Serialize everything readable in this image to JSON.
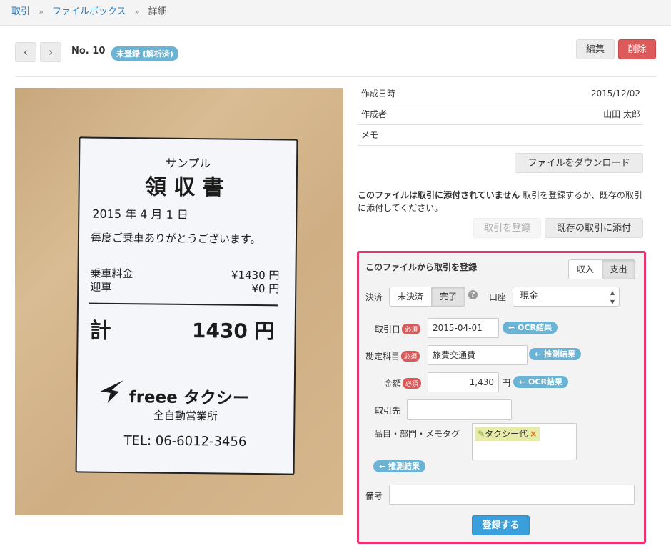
{
  "breadcrumb": {
    "items": [
      "取引",
      "ファイルボックス"
    ],
    "current": "詳細",
    "sep": "»"
  },
  "header": {
    "prev_label": "‹",
    "next_label": "›",
    "record_no": "No. 10",
    "status": "未登録 (解析済)",
    "edit_label": "編集",
    "delete_label": "削除"
  },
  "receipt": {
    "sample": "サンプル",
    "title": "領収書",
    "date": "2015 年 4 月 1 日",
    "thanks": "毎度ご乗車ありがとうございます。",
    "fare_label": "乗車料金",
    "fare_value": "¥1430 円",
    "pickup_label": "迎車",
    "pickup_value": "¥0 円",
    "total_label": "計",
    "total_value": "1430 円",
    "brand": "freee タクシー",
    "office": "全自動営業所",
    "tel": "TEL: 06-6012-3456"
  },
  "info": {
    "created_at_label": "作成日時",
    "created_at": "2015/12/02",
    "author_label": "作成者",
    "author": "山田 太郎",
    "memo_label": "メモ",
    "memo": ""
  },
  "download_label": "ファイルをダウンロード",
  "notice": {
    "bold": "このファイルは取引に添付されていません",
    "rest": "取引を登録するか、既存の取引に添付してください。"
  },
  "actions": {
    "register": "取引を登録",
    "attach": "既存の取引に添付"
  },
  "form": {
    "title": "このファイルから取引を登録",
    "income": "収入",
    "expense": "支出",
    "settlement_label": "決済",
    "unsettled": "未決済",
    "settled": "完了",
    "help": "?",
    "account_label": "口座",
    "account_value": "現金",
    "required": "必須",
    "date_label": "取引日",
    "date_value": "2015-04-01",
    "date_hint": "← OCR結果",
    "category_label": "勘定科目",
    "category_value": "旅費交通費",
    "category_hint": "← 推測結果",
    "amount_label": "金額",
    "amount_value": "1,430",
    "amount_unit": "円",
    "amount_hint": "← OCR結果",
    "partner_label": "取引先",
    "partner_value": "",
    "tags_label": "品目・部門・メモタグ",
    "tag_chip": "タクシー代",
    "tag_remove": "×",
    "tags_hint": "← 推測結果",
    "note_label": "備考",
    "note_value": "",
    "submit": "登録する"
  },
  "colors": {
    "accent": "#e8336e",
    "link": "#2b7fc3",
    "pill": "#6ab3d4",
    "danger": "#dc5a5a",
    "primary": "#3a9fdb"
  }
}
